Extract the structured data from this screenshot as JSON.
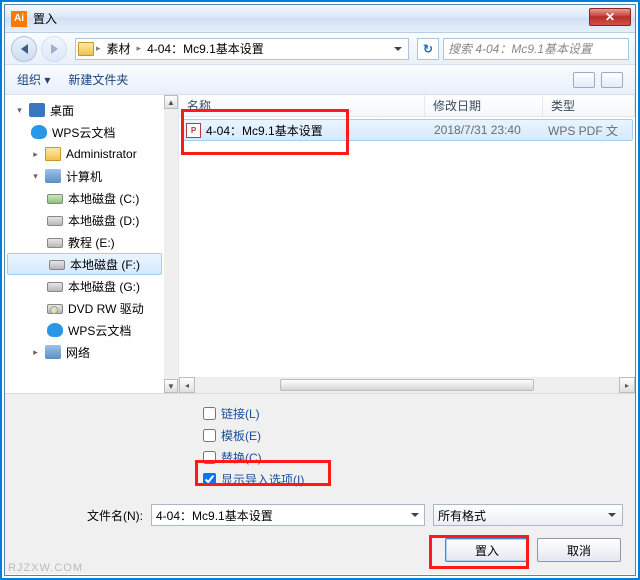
{
  "window": {
    "title": "置入",
    "close_glyph": "✕"
  },
  "nav": {
    "breadcrumb": [
      "素材",
      "4-04：Mc9.1基本设置"
    ],
    "search_placeholder": "搜索 4-04：Mc9.1基本设置",
    "refresh_glyph": "↻"
  },
  "toolbar": {
    "organize": "组织 ▾",
    "new_folder": "新建文件夹"
  },
  "tree": {
    "desktop": "桌面",
    "items": [
      {
        "label": "WPS云文档",
        "icon": "cloud"
      },
      {
        "label": "Administrator",
        "icon": "user"
      },
      {
        "label": "计算机",
        "icon": "computer",
        "expandable": true
      }
    ],
    "drives": [
      {
        "label": "本地磁盘 (C:)",
        "icon": "sys"
      },
      {
        "label": "本地磁盘 (D:)",
        "icon": "drive"
      },
      {
        "label": "教程 (E:)",
        "icon": "drive"
      },
      {
        "label": "本地磁盘 (F:)",
        "icon": "drive",
        "selected": true
      },
      {
        "label": "本地磁盘 (G:)",
        "icon": "drive"
      },
      {
        "label": "DVD RW 驱动",
        "icon": "dvd"
      },
      {
        "label": "WPS云文档",
        "icon": "cloud"
      }
    ],
    "network": "网络"
  },
  "list": {
    "columns": {
      "name": "名称",
      "date": "修改日期",
      "type": "类型"
    },
    "file": {
      "name": "4-04：Mc9.1基本设置",
      "date": "2018/7/31 23:40",
      "type": "WPS PDF 文"
    }
  },
  "options": {
    "link": "链接(L)",
    "template": "模板(E)",
    "replace": "替换(C)",
    "show_import": "显示导入选项(I)",
    "show_import_checked": true
  },
  "bottom": {
    "filename_label": "文件名(N):",
    "filename_value": "4-04：Mc9.1基本设置",
    "filter": "所有格式",
    "place": "置入",
    "cancel": "取消"
  },
  "watermark": "RJZXW.COM"
}
